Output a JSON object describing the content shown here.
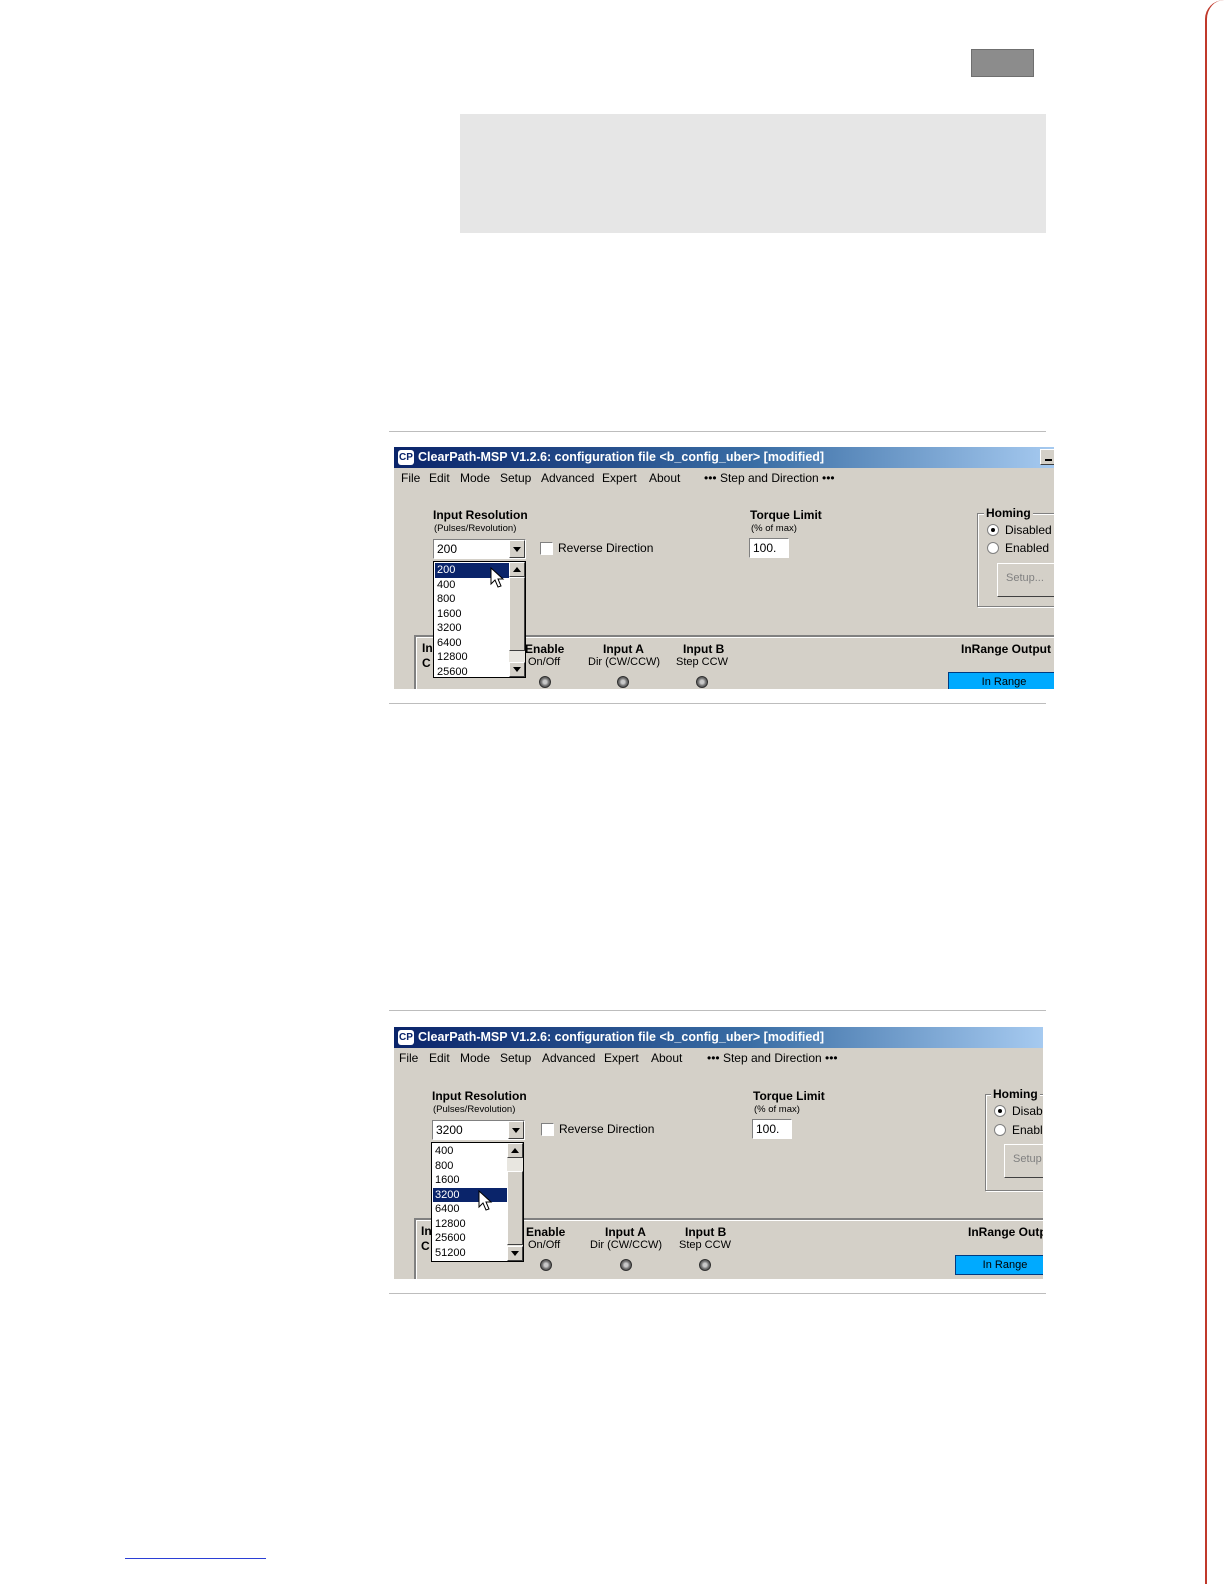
{
  "screenshots": [
    {
      "title": "ClearPath-MSP V1.2.6:  configuration file <b_config_uber> [modified]",
      "app_icon": "CP",
      "menu": [
        "File",
        "Edit",
        "Mode",
        "Setup",
        "Advanced",
        "Expert",
        "About",
        "••• Step and Direction •••"
      ],
      "input_resolution_label": "Input Resolution",
      "input_resolution_sub": "(Pulses/Revolution)",
      "input_resolution_value": "200",
      "reverse_direction_label": "Reverse Direction",
      "torque_limit_label": "Torque Limit",
      "torque_limit_sub": "(% of max)",
      "torque_limit_value": "100.",
      "homing_label": "Homing",
      "homing_disabled": "Disabled",
      "homing_enabled": "Enabled",
      "setup_button": "Setup...",
      "panel_left_label1": "In",
      "panel_left_label2": "C",
      "enable_label": "Enable",
      "enable_sub": "On/Off",
      "input_a_label": "Input A",
      "input_a_sub": "Dir (CW/CCW)",
      "input_b_label": "Input B",
      "input_b_sub": "Step CCW",
      "inrange_output_label": "InRange Output",
      "inrange_button": "In Range",
      "dropdown_options": [
        "200",
        "400",
        "800",
        "1600",
        "3200",
        "6400",
        "12800",
        "25600"
      ],
      "selected_option": "200"
    },
    {
      "title": "ClearPath-MSP V1.2.6:  configuration file <b_config_uber> [modified]",
      "app_icon": "CP",
      "menu": [
        "File",
        "Edit",
        "Mode",
        "Setup",
        "Advanced",
        "Expert",
        "About",
        "••• Step and Direction •••"
      ],
      "input_resolution_label": "Input Resolution",
      "input_resolution_sub": "(Pulses/Revolution)",
      "input_resolution_value": "3200",
      "reverse_direction_label": "Reverse Direction",
      "torque_limit_label": "Torque Limit",
      "torque_limit_sub": "(% of max)",
      "torque_limit_value": "100.",
      "homing_label": "Homing",
      "homing_disabled": "Disabl",
      "homing_enabled": "Enable",
      "setup_button": "Setup",
      "panel_left_label1": "In",
      "panel_left_label2": "C",
      "enable_label": "Enable",
      "enable_sub": "On/Off",
      "input_a_label": "Input A",
      "input_a_sub": "Dir (CW/CCW)",
      "input_b_label": "Input B",
      "input_b_sub": "Step CCW",
      "inrange_output_label": "InRange Outp",
      "inrange_button": "In Range",
      "dropdown_options": [
        "400",
        "800",
        "1600",
        "3200",
        "6400",
        "12800",
        "25600",
        "51200"
      ],
      "selected_option": "3200"
    }
  ],
  "colors": {
    "titlebar_start": "#0a246a",
    "selection": "#0a246a",
    "inrange_fill": "#00aaff",
    "window_face": "#d4d0c8",
    "page_edge": "#c0392b"
  }
}
